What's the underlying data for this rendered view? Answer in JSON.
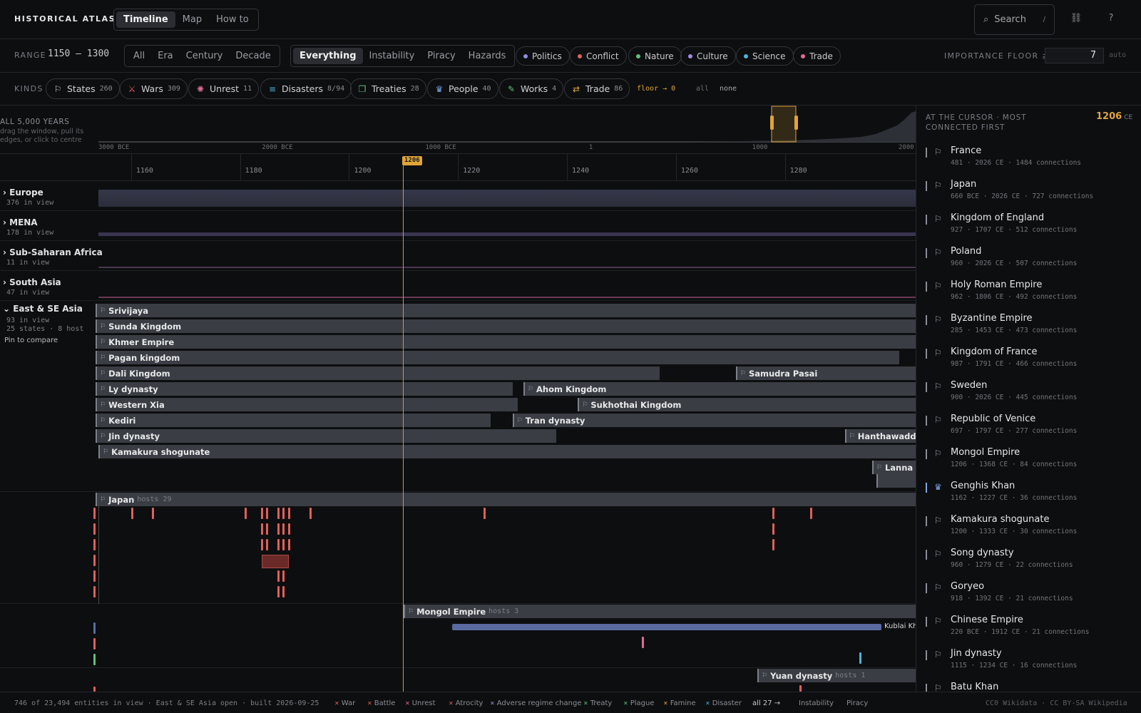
{
  "app": {
    "title": "HISTORICAL ATLAS",
    "view_tabs": [
      "Timeline",
      "Map",
      "How to"
    ],
    "active_view": "Timeline",
    "search_label": "Search",
    "search_shortcut": "/"
  },
  "filters": {
    "range_label": "RANGE",
    "range_value": "1150 — 1300",
    "granularity": [
      "All",
      "Era",
      "Century",
      "Decade"
    ],
    "modes": [
      "Everything",
      "Instability",
      "Piracy",
      "Hazards"
    ],
    "active_mode": "Everything",
    "categories": [
      {
        "label": "Politics",
        "color": "#8f8ce6"
      },
      {
        "label": "Conflict",
        "color": "#e0605a"
      },
      {
        "label": "Nature",
        "color": "#5cc07a"
      },
      {
        "label": "Culture",
        "color": "#a58ae6"
      },
      {
        "label": "Science",
        "color": "#4fb3d9"
      },
      {
        "label": "Trade",
        "color": "#e06b94"
      }
    ],
    "importance_label": "IMPORTANCE FLOOR ≥",
    "importance_value": "7",
    "auto_label": "auto"
  },
  "kinds": {
    "label": "KINDS",
    "items": [
      {
        "label": "States",
        "count": "260",
        "icon": "flag-icon",
        "glyph": "⚐",
        "color": "#c9cbd0"
      },
      {
        "label": "Wars",
        "count": "309",
        "icon": "crossed-swords-icon",
        "glyph": "⚔",
        "color": "#e0605a"
      },
      {
        "label": "Unrest",
        "count": "11",
        "icon": "megaphone-icon",
        "glyph": "✺",
        "color": "#e06b94"
      },
      {
        "label": "Disasters",
        "count": "8/94",
        "icon": "filter-icon",
        "glyph": "≡",
        "color": "#4fb3d9"
      },
      {
        "label": "Treaties",
        "count": "28",
        "icon": "scroll-icon",
        "glyph": "❐",
        "color": "#5cc07a"
      },
      {
        "label": "People",
        "count": "40",
        "icon": "crown-icon",
        "glyph": "♛",
        "color": "#7ea6e6"
      },
      {
        "label": "Works",
        "count": "4",
        "icon": "quill-icon",
        "glyph": "✎",
        "color": "#5cc07a"
      },
      {
        "label": "Trade",
        "count": "86",
        "icon": "route-icon",
        "glyph": "⇄",
        "color": "#e0a43a"
      }
    ],
    "floor_label": "floor → 0",
    "all_label": "all",
    "none_label": "none"
  },
  "overview": {
    "title": "ALL 5,000 YEARS",
    "hint": "drag the window, pull its edges, or click to centre",
    "ticks": [
      "3000 BCE",
      "2000 BCE",
      "1000 BCE",
      "1",
      "1000",
      "2000"
    ]
  },
  "axis": {
    "ticks": [
      "1160",
      "1180",
      "1200",
      "1220",
      "1240",
      "1260",
      "1280"
    ],
    "cursor_year": "1206"
  },
  "regions": [
    {
      "name": "Europe",
      "count": "376 in view",
      "expanded": false
    },
    {
      "name": "MENA",
      "count": "178 in view",
      "expanded": false
    },
    {
      "name": "Sub-Saharan Africa",
      "count": "11 in view",
      "expanded": false
    },
    {
      "name": "South Asia",
      "count": "47 in view",
      "expanded": false
    },
    {
      "name": "East & SE Asia",
      "count": "93 in view",
      "detail": "25 states · 8 host",
      "pin_label": "Pin to compare",
      "expanded": true
    }
  ],
  "states": [
    {
      "name": "Srivijaya",
      "start": 1150,
      "end": 1300
    },
    {
      "name": "Sunda Kingdom",
      "start": 1150,
      "end": 1300
    },
    {
      "name": "Khmer Empire",
      "start": 1150,
      "end": 1300
    },
    {
      "name": "Pagan kingdom",
      "start": 1150,
      "end": 1297
    },
    {
      "name": "Dali Kingdom",
      "start": 1150,
      "end": 1253
    },
    {
      "name": "Samudra Pasai",
      "start": 1267,
      "end": 1300
    },
    {
      "name": "Ly dynasty",
      "start": 1150,
      "end": 1226
    },
    {
      "name": "Ahom Kingdom",
      "start": 1228,
      "end": 1300
    },
    {
      "name": "Western Xia",
      "start": 1150,
      "end": 1227
    },
    {
      "name": "Sukhothai Kingdom",
      "start": 1238,
      "end": 1300
    },
    {
      "name": "Kediri",
      "start": 1150,
      "end": 1222
    },
    {
      "name": "Tran dynasty",
      "start": 1226,
      "end": 1300
    },
    {
      "name": "Jin dynasty",
      "start": 1150,
      "end": 1234
    },
    {
      "name": "Hanthawaddy Kingdom",
      "start": 1287,
      "end": 1300
    },
    {
      "name": "Kamakura shogunate",
      "start": 1150,
      "end": 1300
    },
    {
      "name": "Lanna",
      "start": 1292,
      "end": 1300
    }
  ],
  "hosts": [
    {
      "name": "Japan",
      "hosts_label": "hosts 29"
    },
    {
      "name": "Mongol Empire",
      "hosts_label": "hosts 3",
      "child": "Kublai Khan"
    },
    {
      "name": "Yuan dynasty",
      "hosts_label": "hosts 1"
    }
  ],
  "right_panel": {
    "title": "AT THE CURSOR · MOST CONNECTED FIRST",
    "year": "1206",
    "era": "CE",
    "items": [
      {
        "name": "France",
        "meta": "481 · 2026 CE · 1484 connections",
        "icon": "flag-icon"
      },
      {
        "name": "Japan",
        "meta": "660 BCE · 2026 CE · 727 connections",
        "icon": "flag-icon"
      },
      {
        "name": "Kingdom of England",
        "meta": "927 · 1707 CE · 512 connections",
        "icon": "flag-icon"
      },
      {
        "name": "Poland",
        "meta": "960 · 2026 CE · 507 connections",
        "icon": "flag-icon"
      },
      {
        "name": "Holy Roman Empire",
        "meta": "962 · 1806 CE · 492 connections",
        "icon": "flag-icon"
      },
      {
        "name": "Byzantine Empire",
        "meta": "285 · 1453 CE · 473 connections",
        "icon": "flag-icon"
      },
      {
        "name": "Kingdom of France",
        "meta": "987 · 1791 CE · 466 connections",
        "icon": "flag-icon"
      },
      {
        "name": "Sweden",
        "meta": "900 · 2026 CE · 445 connections",
        "icon": "flag-icon"
      },
      {
        "name": "Republic of Venice",
        "meta": "697 · 1797 CE · 277 connections",
        "icon": "flag-icon"
      },
      {
        "name": "Mongol Empire",
        "meta": "1206 · 1368 CE · 84 connections",
        "icon": "flag-icon"
      },
      {
        "name": "Genghis Khan",
        "meta": "1162 · 1227 CE · 36 connections",
        "icon": "crown-icon"
      },
      {
        "name": "Kamakura shogunate",
        "meta": "1200 · 1333 CE · 30 connections",
        "icon": "flag-icon"
      },
      {
        "name": "Song dynasty",
        "meta": "960 · 1279 CE · 22 connections",
        "icon": "flag-icon"
      },
      {
        "name": "Goryeo",
        "meta": "918 · 1392 CE · 21 connections",
        "icon": "flag-icon"
      },
      {
        "name": "Chinese Empire",
        "meta": "220 BCE · 1912 CE · 21 connections",
        "icon": "flag-icon"
      },
      {
        "name": "Jin dynasty",
        "meta": "1115 · 1234 CE · 16 connections",
        "icon": "flag-icon"
      },
      {
        "name": "Batu Khan",
        "meta": "",
        "icon": "flag-icon"
      }
    ]
  },
  "footer": {
    "status": "746 of 23,494 entities in view · East & SE Asia open · built 2026-09-25",
    "legend": [
      {
        "label": "War",
        "color": "#e0605a"
      },
      {
        "label": "Battle",
        "color": "#e0605a"
      },
      {
        "label": "Unrest",
        "color": "#e06b94"
      },
      {
        "label": "Atrocity",
        "color": "#e0605a"
      },
      {
        "label": "Adverse regime change",
        "color": "#a58ae6"
      },
      {
        "label": "Treaty",
        "color": "#5cc07a"
      },
      {
        "label": "Plague",
        "color": "#5cc07a"
      },
      {
        "label": "Famine",
        "color": "#e0a43a"
      },
      {
        "label": "Disaster",
        "color": "#4fb3d9"
      }
    ],
    "all_link": "all 27 →",
    "extra": [
      "Instability",
      "Piracy"
    ],
    "credit": "CC0 Wikidata · CC BY-SA Wikipedia"
  }
}
